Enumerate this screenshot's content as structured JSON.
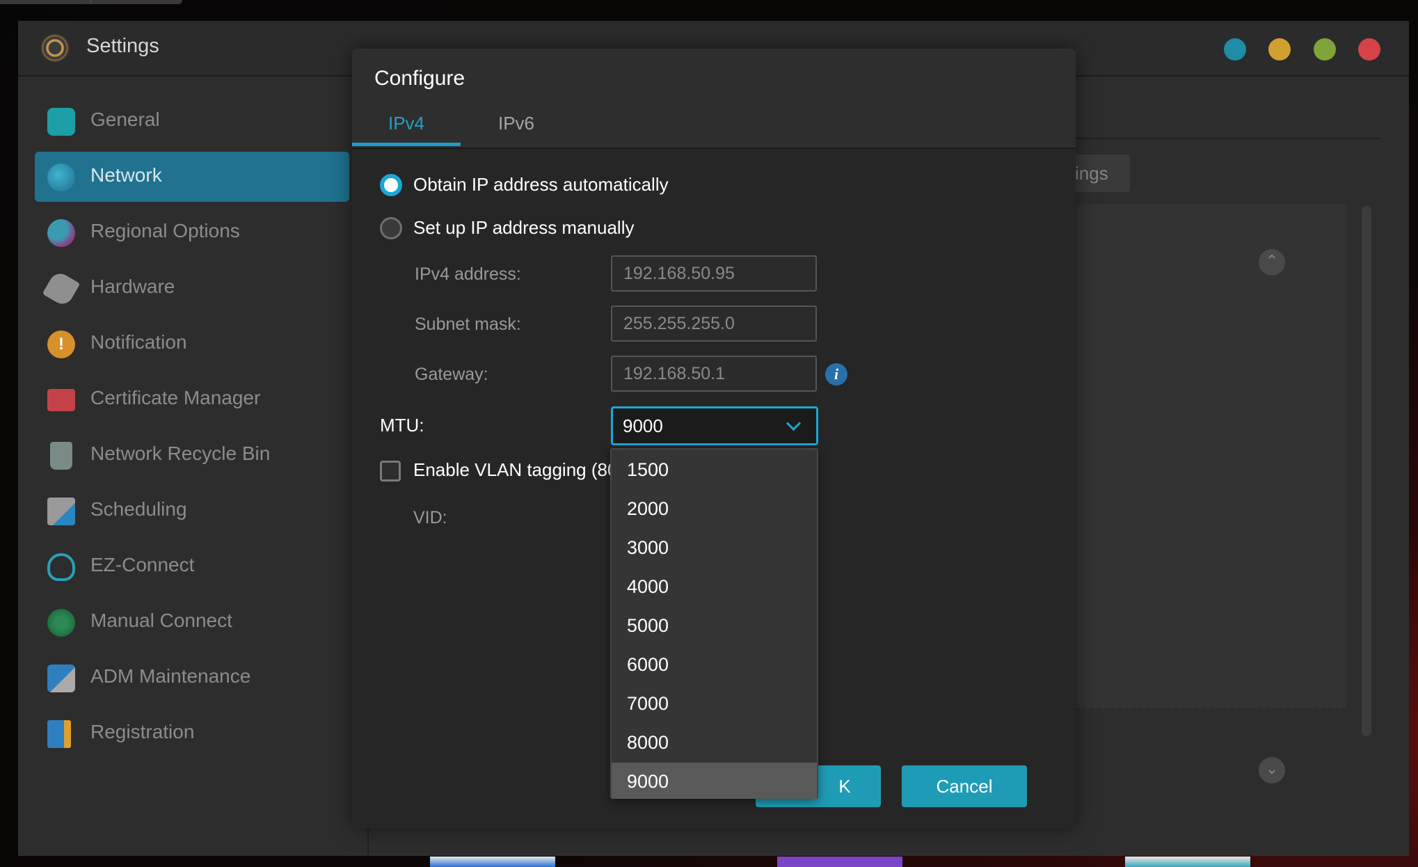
{
  "window": {
    "title": "Settings",
    "logo_icon": "settings-gear-icon",
    "controls": [
      {
        "name": "window-control-teal",
        "color": "#1f8ca8"
      },
      {
        "name": "window-control-yellow",
        "color": "#d2a030"
      },
      {
        "name": "window-control-green",
        "color": "#7ea43a"
      },
      {
        "name": "window-control-red",
        "color": "#d64247"
      }
    ]
  },
  "sidebar": {
    "items": [
      {
        "label": "General",
        "icon": "general-icon",
        "active": false
      },
      {
        "label": "Network",
        "icon": "globe-icon",
        "active": true
      },
      {
        "label": "Regional Options",
        "icon": "regional-options-icon",
        "active": false
      },
      {
        "label": "Hardware",
        "icon": "hardware-wrench-icon",
        "active": false
      },
      {
        "label": "Notification",
        "icon": "notification-alert-icon",
        "active": false
      },
      {
        "label": "Certificate Manager",
        "icon": "certificate-icon",
        "active": false
      },
      {
        "label": "Network Recycle Bin",
        "icon": "recycle-bin-icon",
        "active": false
      },
      {
        "label": "Scheduling",
        "icon": "calendar-clock-icon",
        "active": false
      },
      {
        "label": "EZ-Connect",
        "icon": "cloud-upload-icon",
        "active": false
      },
      {
        "label": "Manual Connect",
        "icon": "network-nodes-icon",
        "active": false
      },
      {
        "label": "ADM Maintenance",
        "icon": "maintenance-gear-icon",
        "active": false
      },
      {
        "label": "Registration",
        "icon": "registration-book-icon",
        "active": false
      }
    ]
  },
  "background": {
    "settings_button_partial": "ings"
  },
  "dialog": {
    "title": "Configure",
    "tabs": [
      {
        "label": "IPv4",
        "active": true
      },
      {
        "label": "IPv6",
        "active": false
      }
    ],
    "options": {
      "auto": {
        "label": "Obtain IP address automatically",
        "selected": true
      },
      "manual": {
        "label": "Set up IP address manually",
        "selected": false
      }
    },
    "fields": {
      "ipv4_label": "IPv4 address:",
      "ipv4_value": "192.168.50.95",
      "subnet_label": "Subnet mask:",
      "subnet_value": "255.255.255.0",
      "gateway_label": "Gateway:",
      "gateway_value": "192.168.50.1"
    },
    "mtu": {
      "label": "MTU:",
      "value": "9000",
      "options": [
        "1500",
        "2000",
        "3000",
        "4000",
        "5000",
        "6000",
        "7000",
        "8000",
        "9000"
      ],
      "selected_index": 8
    },
    "vlan": {
      "label": "Enable VLAN tagging (80",
      "checked": false,
      "vid_label": "VID:"
    },
    "buttons": {
      "ok_label": "K",
      "cancel_label": "Cancel"
    }
  },
  "colors": {
    "accent": "#1aa7d6",
    "sidebar_active": "#20728f",
    "button": "#1f9cb5"
  }
}
